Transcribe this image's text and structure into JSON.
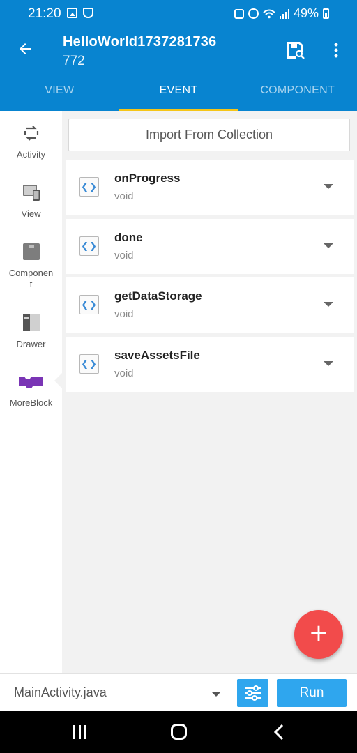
{
  "status_bar": {
    "time": "21:20",
    "battery": "49%"
  },
  "app_bar": {
    "title": "HelloWorld1737281736",
    "subtitle": "772"
  },
  "tabs": [
    {
      "label": "VIEW",
      "active": false
    },
    {
      "label": "EVENT",
      "active": true
    },
    {
      "label": "COMPONENT",
      "active": false
    }
  ],
  "sidebar": {
    "items": [
      {
        "label": "Activity",
        "icon": "refresh-icon"
      },
      {
        "label": "View",
        "icon": "devices-icon"
      },
      {
        "label": "Componen\nt",
        "icon": "component-box-icon"
      },
      {
        "label": "Drawer",
        "icon": "drawer-icon"
      },
      {
        "label": "MoreBlock",
        "icon": "moreblock-icon",
        "selected": true
      }
    ]
  },
  "import_button": "Import From Collection",
  "events": [
    {
      "name": "onProgress",
      "type": "void"
    },
    {
      "name": "done",
      "type": "void"
    },
    {
      "name": "getDataStorage",
      "type": "void"
    },
    {
      "name": "saveAssetsFile",
      "type": "void"
    }
  ],
  "event_icon_glyph": "❮❯",
  "fab": {
    "glyph": "+"
  },
  "bottom_bar": {
    "file": "MainActivity.java",
    "run_label": "Run"
  },
  "colors": {
    "primary": "#0884d0",
    "tab_indicator": "#f5c518",
    "fab": "#f24b4b",
    "button": "#2fa6ee",
    "moreblock": "#7a35b5"
  }
}
